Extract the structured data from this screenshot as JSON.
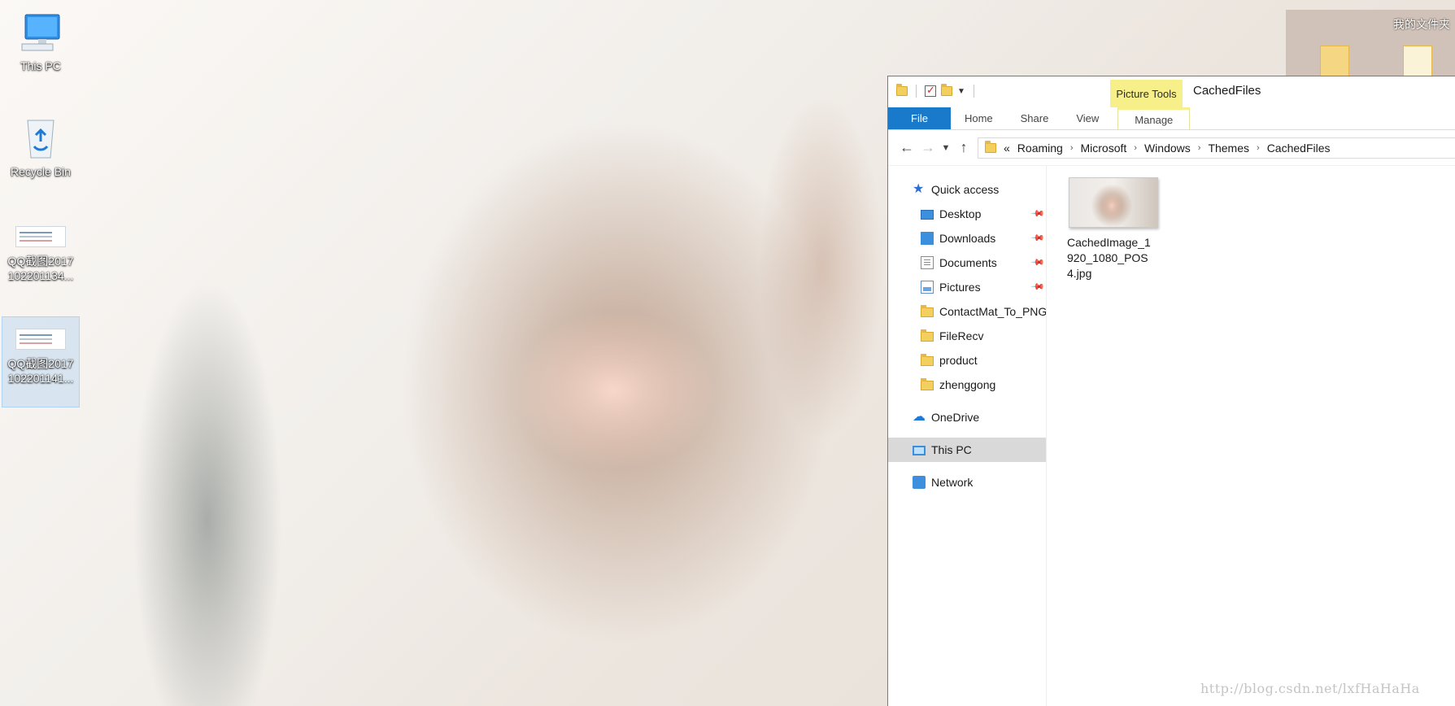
{
  "desktop": {
    "icons": [
      {
        "label": "This PC"
      },
      {
        "label": "Recycle Bin"
      },
      {
        "label_line1": "QQ截图2017",
        "label_line2": "102201134..."
      },
      {
        "label_line1": "QQ截图2017",
        "label_line2": "102201141..."
      }
    ],
    "top_right_folder_title": "我的文件夹"
  },
  "explorer": {
    "contextual_tab_header": "Picture Tools",
    "window_title": "CachedFiles",
    "ribbon_tabs": [
      "File",
      "Home",
      "Share",
      "View",
      "Manage"
    ],
    "address": {
      "overflow": "«",
      "segments": [
        "Roaming",
        "Microsoft",
        "Windows",
        "Themes",
        "CachedFiles"
      ]
    },
    "nav": {
      "quick_access": "Quick access",
      "pinned": [
        "Desktop",
        "Downloads",
        "Documents",
        "Pictures"
      ],
      "recent": [
        "ContactMat_To_PNG",
        "FileRecv",
        "product",
        "zhenggong"
      ],
      "onedrive": "OneDrive",
      "this_pc": "This PC",
      "network": "Network"
    },
    "files": [
      {
        "name": "CachedImage_1920_1080_POS4.jpg"
      }
    ]
  },
  "watermark": "http://blog.csdn.net/lxfHaHaHa"
}
